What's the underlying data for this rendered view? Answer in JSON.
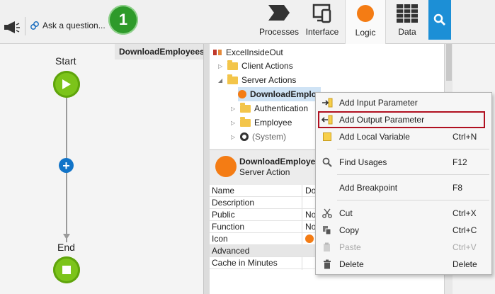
{
  "toolbar": {
    "ask_label": "Ask a question...",
    "badge_number": "1",
    "tabs": [
      {
        "label": "Processes"
      },
      {
        "label": "Interface"
      },
      {
        "label": "Logic"
      },
      {
        "label": "Data"
      }
    ]
  },
  "canvas": {
    "tooltip": "DownloadEmployees",
    "start_label": "Start",
    "end_label": "End"
  },
  "tree": {
    "root": "ExcelInsideOut",
    "client_actions": "Client Actions",
    "server_actions": "Server Actions",
    "selected": "DownloadEmplo",
    "authentication": "Authentication",
    "employee": "Employee",
    "system": "(System)"
  },
  "properties": {
    "title": "DownloadEmployee",
    "subtitle": "Server Action",
    "rows": [
      {
        "key": "Name",
        "value": "Do"
      },
      {
        "key": "Description",
        "value": ""
      },
      {
        "key": "Public",
        "value": "No"
      },
      {
        "key": "Function",
        "value": "No"
      },
      {
        "key": "Icon",
        "value": ""
      },
      {
        "key": "Advanced",
        "value": ""
      },
      {
        "key": "Cache in Minutes",
        "value": ""
      }
    ]
  },
  "context_menu": {
    "items": [
      {
        "label": "Add Input Parameter",
        "shortcut": "",
        "icon": "input-param-icon"
      },
      {
        "label": "Add Output Parameter",
        "shortcut": "",
        "icon": "output-param-icon"
      },
      {
        "label": "Add Local Variable",
        "shortcut": "Ctrl+N",
        "icon": "local-variable-icon"
      },
      {
        "label": "Find Usages",
        "shortcut": "F12",
        "icon": "search-icon"
      },
      {
        "label": "Add Breakpoint",
        "shortcut": "F8",
        "icon": ""
      },
      {
        "label": "Cut",
        "shortcut": "Ctrl+X",
        "icon": "scissors-icon"
      },
      {
        "label": "Copy",
        "shortcut": "Ctrl+C",
        "icon": "copy-icon"
      },
      {
        "label": "Paste",
        "shortcut": "Ctrl+V",
        "icon": "paste-icon"
      },
      {
        "label": "Delete",
        "shortcut": "Delete",
        "icon": "trash-icon"
      }
    ]
  },
  "colors": {
    "accent_blue": "#1c8fd6",
    "logic_orange": "#f47c14",
    "flow_green": "#7cc41a",
    "highlight_red": "#b01020"
  }
}
